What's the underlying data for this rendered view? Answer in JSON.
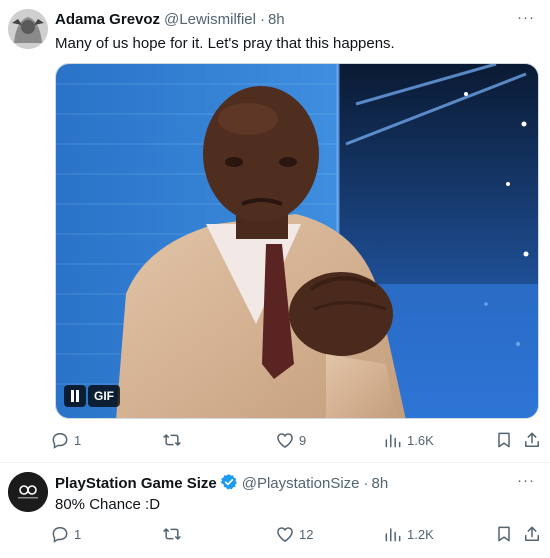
{
  "tweets": [
    {
      "author_name": "Adama Grevoz",
      "handle": "@Lewismilfiel",
      "time": "8h",
      "text": "Many of us hope for it. Let's pray that this happens.",
      "media_badge": "GIF",
      "replies": "1",
      "reposts": "",
      "likes": "9",
      "views": "1.6K"
    },
    {
      "author_name": "PlayStation Game Size",
      "handle": "@PlaystationSize",
      "time": "8h",
      "text": "80% Chance :D",
      "replies": "1",
      "reposts": "",
      "likes": "12",
      "views": "1.2K"
    }
  ],
  "more_label": "···",
  "meta_separator": "·",
  "colors": {
    "verified": "#1d9bf0",
    "muted": "#536471",
    "text": "#0f1419"
  }
}
